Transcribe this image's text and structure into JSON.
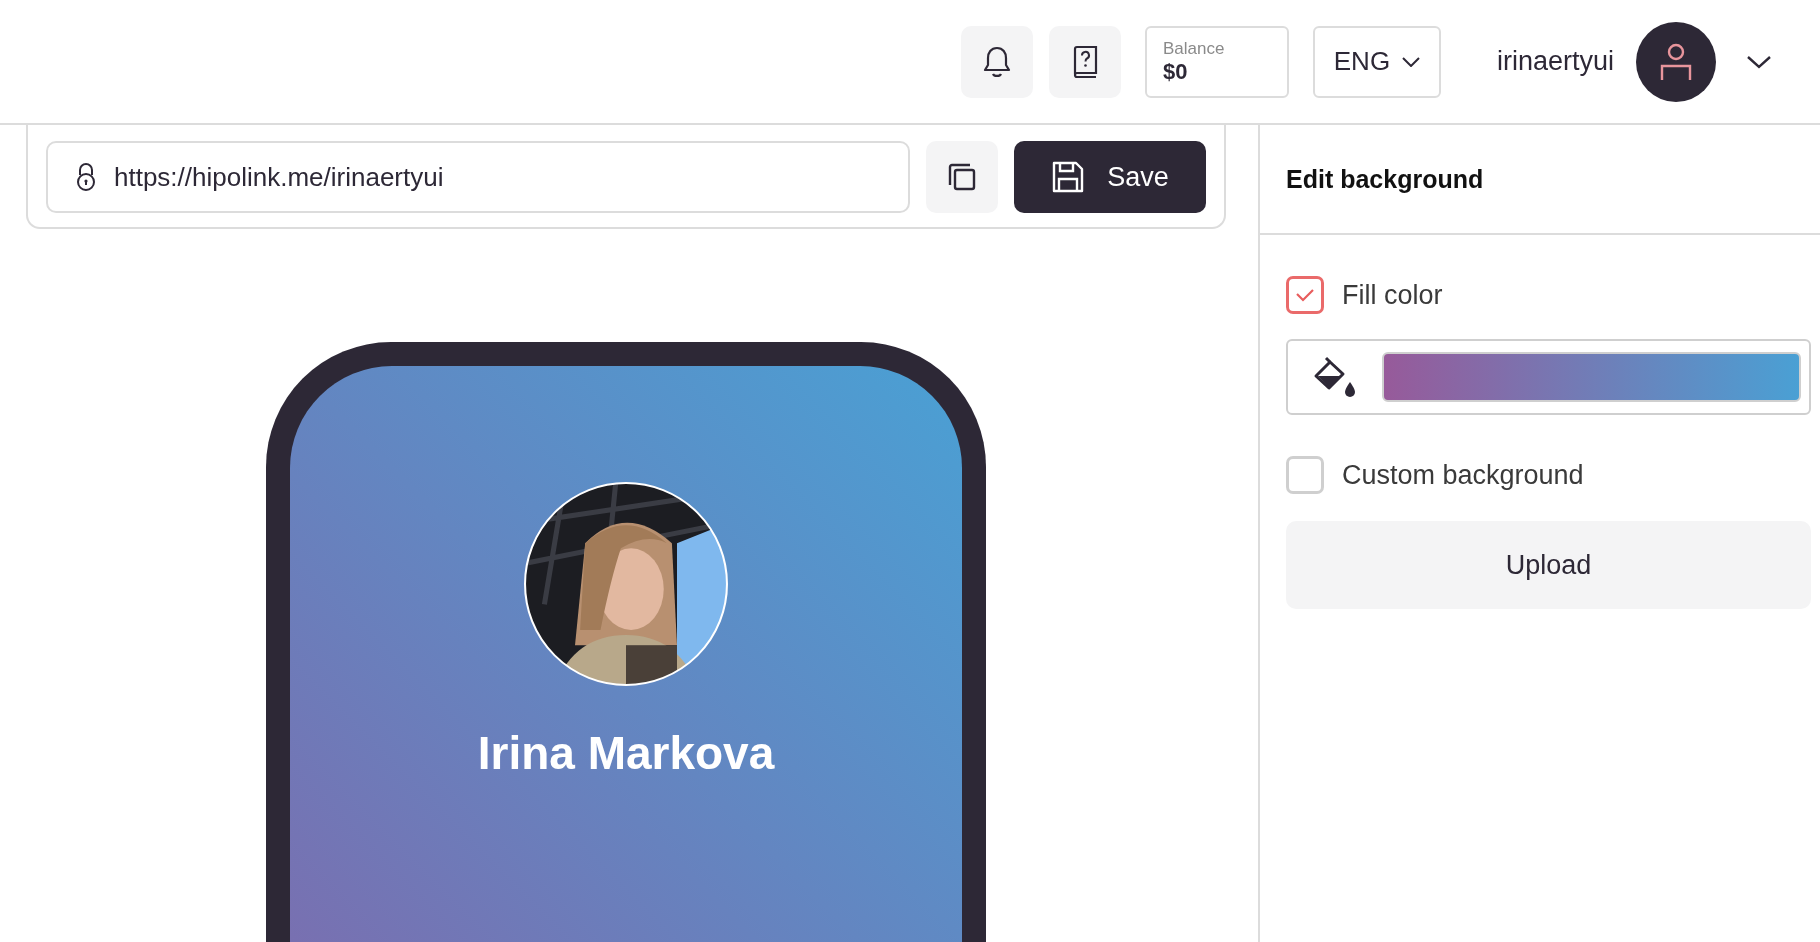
{
  "header": {
    "balance": {
      "label": "Balance",
      "value": "$0"
    },
    "language": "ENG",
    "username": "irinaertyui"
  },
  "link_bar": {
    "url": "https://hipolink.me/irinaertyui",
    "save_label": "Save"
  },
  "preview": {
    "profile_name": "Irina Markova"
  },
  "panel": {
    "title": "Edit background",
    "fill_color": {
      "label": "Fill color",
      "checked": true
    },
    "custom_background": {
      "label": "Custom background",
      "checked": false,
      "button": "Upload"
    }
  }
}
